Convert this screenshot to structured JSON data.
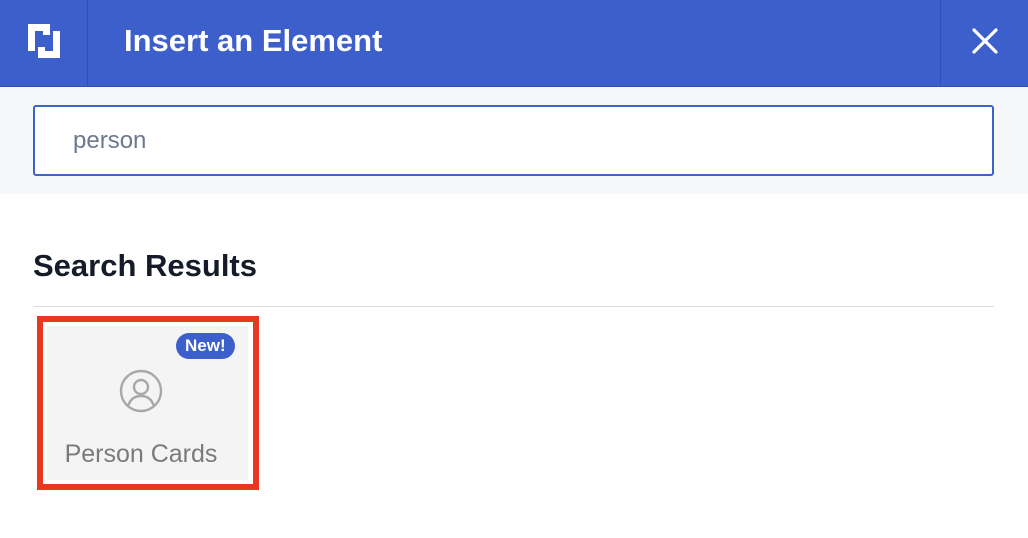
{
  "header": {
    "logo_icon": "builder-logo-icon",
    "title": "Insert an Element",
    "close_icon": "close-icon"
  },
  "search": {
    "value": "person",
    "placeholder": ""
  },
  "results": {
    "heading": "Search Results",
    "items": [
      {
        "label": "Person Cards",
        "badge": "New!",
        "icon": "person-circle-icon"
      }
    ]
  },
  "colors": {
    "header_bg": "#3c5fcb",
    "highlight_border": "#e8381f",
    "badge_bg": "#3c5fcb",
    "search_border": "#3d63c9"
  }
}
